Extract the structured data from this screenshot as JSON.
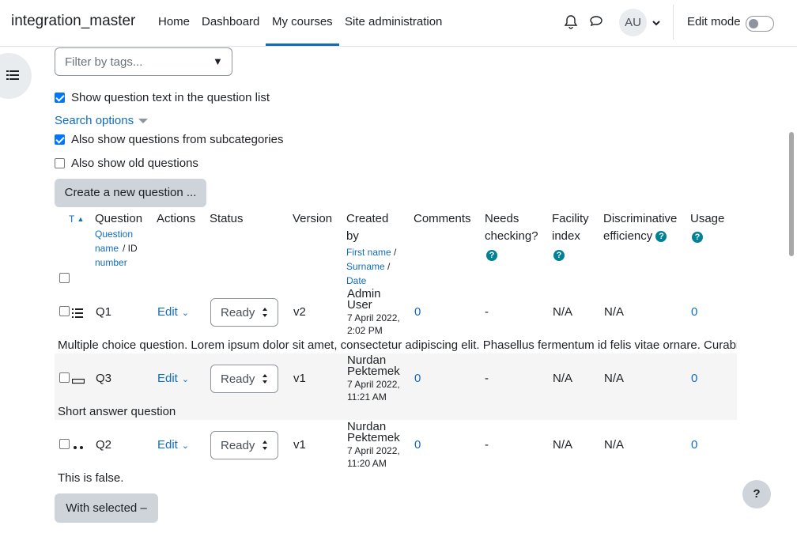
{
  "navbar": {
    "brand": "integration_master",
    "items": [
      "Home",
      "Dashboard",
      "My courses",
      "Site administration"
    ],
    "avatar": "AU",
    "edit_mode_label": "Edit mode"
  },
  "filters": {
    "tags_placeholder": "Filter by tags...",
    "show_question_text": "Show question text in the question list",
    "search_options": "Search options",
    "show_subcategories": "Also show questions from subcategories",
    "show_old": "Also show old questions"
  },
  "actions": {
    "create_new": "Create a new question ...",
    "with_selected": "With selected"
  },
  "table": {
    "headers": {
      "type": "T",
      "question": "Question",
      "question_sub_1": "Question",
      "question_sub_2": "name",
      "question_sub_3": "/ ID",
      "question_sub_4": "number",
      "actions": "Actions",
      "status": "Status",
      "version": "Version",
      "created_1": "Created",
      "created_2": "by",
      "created_sub_first": "First name",
      "created_sub_surname": "Surname",
      "created_sub_date": "Date",
      "comments": "Comments",
      "needs_1": "Needs",
      "needs_2": "checking?",
      "facility_1": "Facility",
      "facility_2": "index",
      "discrim_1": "Discriminative",
      "discrim_2": "efficiency",
      "usage": "Usage"
    },
    "rows": [
      {
        "name": "Q1",
        "edit": "Edit",
        "status": "Ready",
        "version": "v2",
        "creator_first": "Admin",
        "creator_last": "User",
        "date_1": "7 April 2022,",
        "date_2": "2:02 PM",
        "comments": "0",
        "needs": "-",
        "facility": "N/A",
        "discrim": "N/A",
        "usage": "0",
        "text": "Multiple choice question. Lorem ipsum dolor sit amet, consectetur adipiscing elit. Phasellus fermentum id felis vitae ornare. Curabitur"
      },
      {
        "name": "Q3",
        "edit": "Edit",
        "status": "Ready",
        "version": "v1",
        "creator_first": "Nurdan",
        "creator_last": "Pektemek",
        "date_1": "7 April 2022,",
        "date_2": "11:21 AM",
        "comments": "0",
        "needs": "-",
        "facility": "N/A",
        "discrim": "N/A",
        "usage": "0",
        "text": "Short answer question"
      },
      {
        "name": "Q2",
        "edit": "Edit",
        "status": "Ready",
        "version": "v1",
        "creator_first": "Nurdan",
        "creator_last": "Pektemek",
        "date_1": "7 April 2022,",
        "date_2": "11:20 AM",
        "comments": "0",
        "needs": "-",
        "facility": "N/A",
        "discrim": "N/A",
        "usage": "0",
        "text": "This is false."
      }
    ]
  },
  "help_button": "?",
  "colors": {
    "link": "#0f6cbf",
    "help_icon": "#008196",
    "button_bg": "#ced4da"
  }
}
